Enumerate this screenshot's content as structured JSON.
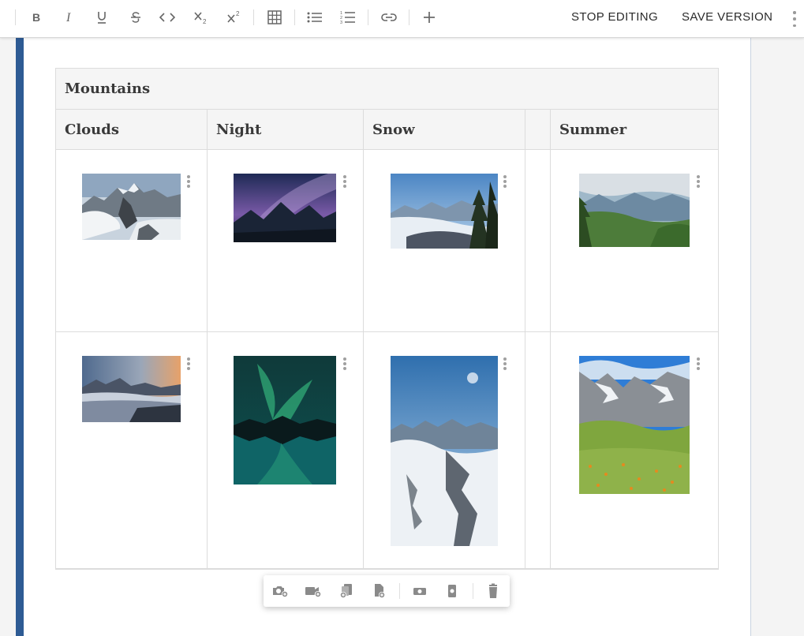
{
  "toolbar": {
    "icons": [
      "bold-icon",
      "italic-icon",
      "underline-icon",
      "strikethrough-icon",
      "code-icon",
      "subscript-icon",
      "superscript-icon",
      "table-icon",
      "bulleted-list-icon",
      "numbered-list-icon",
      "link-icon",
      "plus-icon"
    ],
    "stop_editing": "STOP EDITING",
    "save_version": "SAVE VERSION"
  },
  "table": {
    "caption": "Mountains",
    "headers": [
      "Clouds",
      "Night",
      "Snow",
      "",
      "Summer"
    ],
    "rows": [
      [
        "mountain-peak-above-clouds",
        "milky-way-over-mountains",
        "snowy-valley-with-pines",
        "",
        "green-alpine-valley"
      ],
      [
        "sunset-over-cloud-sea",
        "aurora-over-lake",
        "snowy-peaks-under-sky",
        "",
        "flower-meadow-below-peaks"
      ]
    ]
  },
  "image_toolbar": {
    "icons": [
      "add-image-icon",
      "add-video-icon",
      "add-gallery-icon",
      "add-document-icon",
      "view-image-icon",
      "view-vertical-icon",
      "delete-icon"
    ]
  },
  "colors": {
    "accent_bar": "#2e5b94",
    "toolbar_bg": "#ffffff",
    "header_bg": "#f5f5f5"
  }
}
